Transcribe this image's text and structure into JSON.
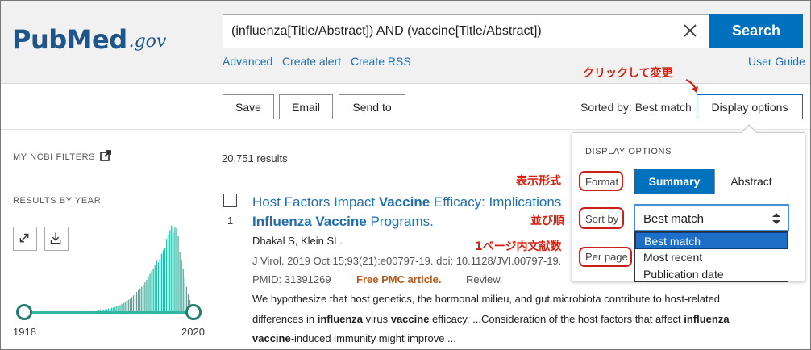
{
  "logo": {
    "pub": "Pub",
    "med": "Med",
    "gov": ".gov"
  },
  "search": {
    "query": "(influenza[Title/Abstract]) AND (vaccine[Title/Abstract])",
    "button_label": "Search"
  },
  "links": {
    "advanced": "Advanced",
    "create_alert": "Create alert",
    "create_rss": "Create RSS",
    "user_guide": "User Guide"
  },
  "annotations": {
    "click_change": "クリックして変更",
    "format": "表示形式",
    "sort_order": "並び順",
    "per_page": "1ページ内文献数"
  },
  "toolbar": {
    "save": "Save",
    "email": "Email",
    "send_to": "Send to",
    "sorted_by": "Sorted by: Best match",
    "display_options": "Display options"
  },
  "sidebar": {
    "my_ncbi_filters": "MY NCBI FILTERS",
    "results_by_year": "RESULTS BY YEAR",
    "year_start": "1918",
    "year_end": "2020"
  },
  "results": {
    "count": "20,751 results",
    "items": [
      {
        "number": "1",
        "title_parts": [
          "Host Factors Impact ",
          "Vaccine",
          " Efficacy: Implications"
        ],
        "title_line2": [
          "Influenza",
          " ",
          "Vaccine",
          " Programs."
        ],
        "authors": "Dhakal S, Klein SL.",
        "citation": "J Virol. 2019 Oct 15;93(21):e00797-19. doi: 10.1128/JVI.00797-19.",
        "pmid": "PMID: 31391269",
        "free_pmc": "Free PMC article.",
        "review": "Review.",
        "snippet_line1": "We hypothesize that host genetics, the hormonal milieu, and gut microbiota contribute to host-related",
        "snippet_line2": [
          "differences in ",
          "influenza",
          " virus ",
          "vaccine",
          " efficacy. ...Consideration of the host factors that affect ",
          "influenza"
        ],
        "snippet_line3": [
          "vaccine",
          "-induced immunity might improve ..."
        ]
      }
    ]
  },
  "display_options": {
    "heading": "DISPLAY OPTIONS",
    "format_label": "Format",
    "format_options": [
      "Summary",
      "Abstract"
    ],
    "format_selected": "Summary",
    "sort_label": "Sort by",
    "sort_selected": "Best match",
    "sort_options": [
      "Best match",
      "Most recent",
      "Publication date"
    ],
    "per_page_label": "Per page"
  },
  "colors": {
    "brand_blue": "#0071bc",
    "annotation_red": "#d8200f",
    "histogram_teal": "#2fb7a4"
  },
  "chart_data": {
    "type": "bar",
    "x": [
      1918,
      2020
    ],
    "values": [
      1,
      1,
      1,
      1,
      1,
      1,
      1,
      1,
      1,
      1,
      1,
      1,
      1,
      1,
      1,
      1,
      1,
      1,
      1,
      1,
      1,
      1,
      1,
      1,
      1,
      1,
      1,
      1,
      1,
      1,
      1,
      1,
      1,
      1,
      1,
      1,
      1,
      1,
      1,
      1,
      2,
      2,
      2,
      2,
      2,
      3,
      3,
      3,
      3,
      4,
      4,
      5,
      5,
      6,
      6,
      7,
      8,
      8,
      9,
      10,
      11,
      12,
      14,
      15,
      16,
      18,
      20,
      22,
      24,
      26,
      28,
      30,
      32,
      35,
      38,
      42,
      45,
      48,
      50,
      55,
      60,
      58,
      62,
      68,
      72,
      75,
      85,
      90,
      95,
      100,
      92,
      98,
      97,
      88,
      70,
      60,
      50,
      40,
      30,
      22,
      15,
      10,
      8
    ],
    "xlim": [
      1918,
      2020
    ]
  }
}
